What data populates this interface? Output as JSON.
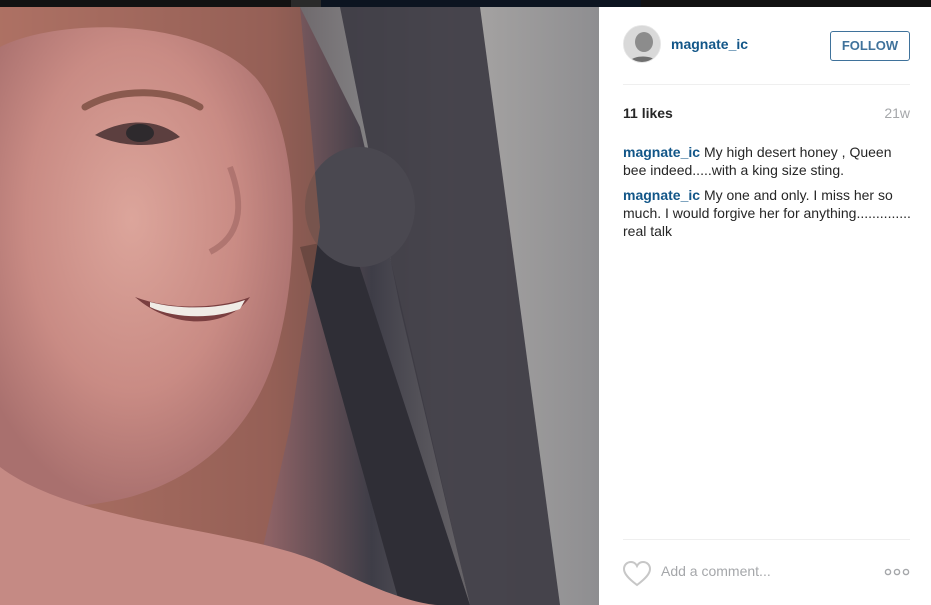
{
  "post": {
    "username": "magnate_ic",
    "follow_label": "FOLLOW",
    "likes": "11 likes",
    "age": "21w",
    "comments": [
      {
        "user": "magnate_ic",
        "text": "My high desert honey , Queen bee indeed.....with a king size sting."
      },
      {
        "user": "magnate_ic",
        "text": "My one and only. I miss her so much. I would forgive her for anything.............. real talk"
      }
    ],
    "add_comment_placeholder": "Add a comment...",
    "icons": {
      "like": "heart-icon",
      "more": "more-options-icon"
    }
  },
  "colors": {
    "link": "#125688",
    "follow_border": "#3f729b",
    "muted": "#a5a7aa"
  }
}
